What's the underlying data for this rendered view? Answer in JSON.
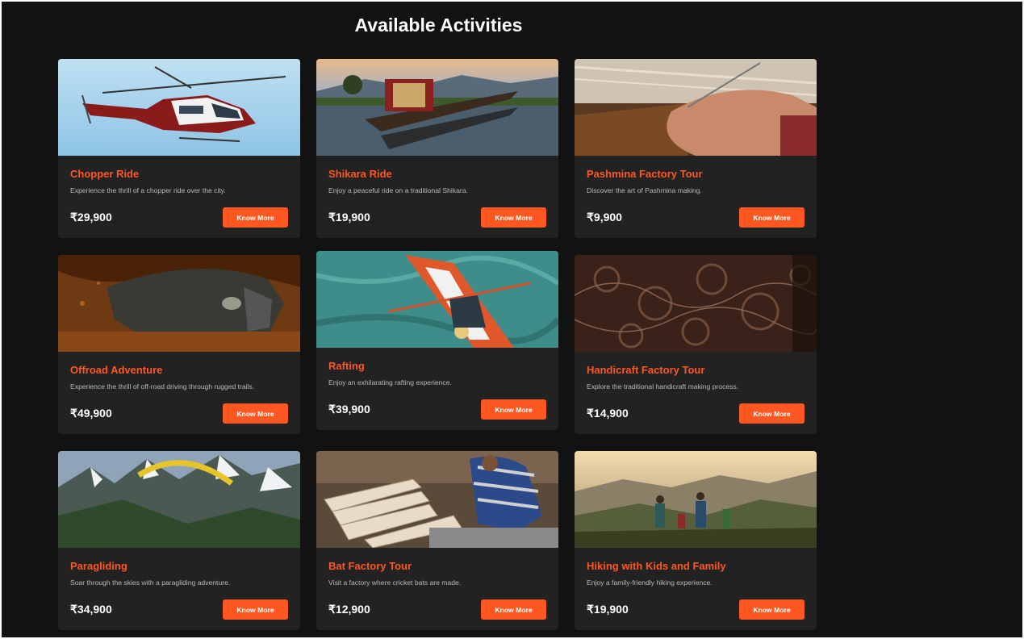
{
  "page": {
    "title": "Available Activities"
  },
  "cta_label": "Know More",
  "currency_symbol": "₹",
  "colors": {
    "accent": "#ff5722",
    "background": "#121212",
    "card": "#222222"
  },
  "activities": [
    {
      "title": "Chopper Ride",
      "description": "Experience the thrill of a chopper ride over the city.",
      "price": "₹29,900",
      "image": "helicopter-image"
    },
    {
      "title": "Shikara Ride",
      "description": "Enjoy a peaceful ride on a traditional Shikara.",
      "price": "₹19,900",
      "image": "shikara-boat-image"
    },
    {
      "title": "Pashmina Factory Tour",
      "description": "Discover the art of Pashmina making.",
      "price": "₹9,900",
      "image": "pashmina-weaving-image"
    },
    {
      "title": "Offroad Adventure",
      "description": "Experience the thrill of off-road driving through rugged trails.",
      "price": "₹49,900",
      "image": "offroad-vehicle-image"
    },
    {
      "title": "Rafting",
      "description": "Enjoy an exhilarating rafting experience.",
      "price": "₹39,900",
      "image": "kayak-rafting-image"
    },
    {
      "title": "Handicraft Factory Tour",
      "description": "Explore the traditional handicraft making process.",
      "price": "₹14,900",
      "image": "wood-carving-image"
    },
    {
      "title": "Paragliding",
      "description": "Soar through the skies with a paragliding adventure.",
      "price": "₹34,900",
      "image": "paraglider-mountains-image"
    },
    {
      "title": "Bat Factory Tour",
      "description": "Visit a factory where cricket bats are made.",
      "price": "₹12,900",
      "image": "cricket-bat-workshop-image"
    },
    {
      "title": "Hiking with Kids and Family",
      "description": "Enjoy a family-friendly hiking experience.",
      "price": "₹19,900",
      "image": "family-hiking-image"
    }
  ]
}
